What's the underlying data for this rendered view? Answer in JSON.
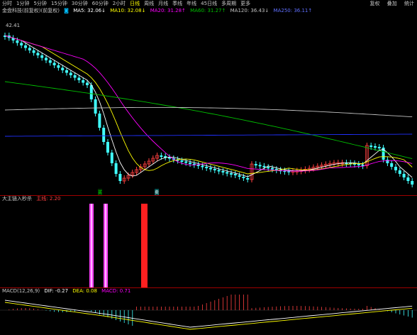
{
  "top_tabs": [
    "分时",
    "1分钟",
    "5分钟",
    "15分钟",
    "30分钟",
    "60分钟",
    "2小时",
    "日线",
    "周线",
    "月线",
    "季线",
    "年线",
    "45日线",
    "多周期",
    "更多"
  ],
  "active_tab_index": 7,
  "right_links": [
    "复权",
    "叠加",
    "统计"
  ],
  "main": {
    "title": "金盘科技(前复权)(前复权)",
    "ma5": "MA5: 32.06↓",
    "ma10": "MA10: 32.08↓",
    "ma20": "MA20: 31.28↑",
    "ma60": "MA60: 31.27↑",
    "ma120": "MA120: 36.43↓",
    "ma250": "MA250: 36.11↑",
    "high_label": "42.41",
    "signal_b": "买",
    "signal_sell": "卖"
  },
  "indicator": {
    "title": "大主链入秒杀",
    "value": "主线: 2.20"
  },
  "macd": {
    "title": "MACD(12,26,9)",
    "dif": "DIF: -0.27",
    "dea": "DEA: 0.08",
    "macd": "MACD: 0.71"
  },
  "colors": {
    "up": "#ff4040",
    "down": "#40ffff",
    "ma5": "#ffffff",
    "ma10": "#ffff00",
    "ma20": "#ff00ff",
    "ma60": "#00c000",
    "ma120": "#c0c0c0",
    "ma250": "#2030ff",
    "signal_magenta": "#ff40ff",
    "signal_red": "#ff2020"
  }
}
